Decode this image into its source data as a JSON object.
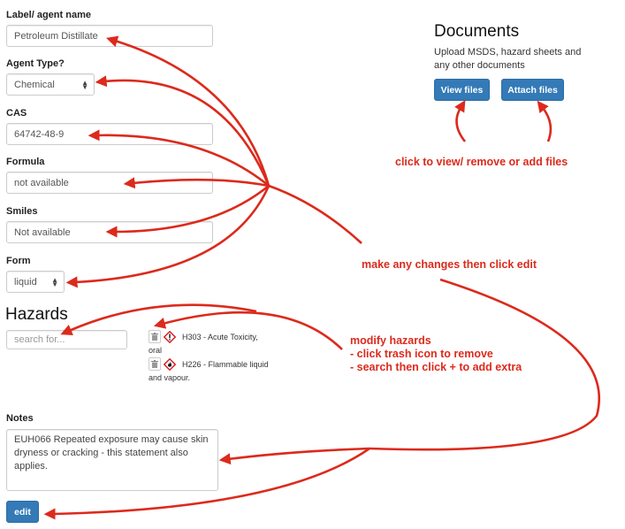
{
  "form": {
    "label_field": {
      "label": "Label/ agent name",
      "value": "Petroleum Distillate"
    },
    "agent_type": {
      "label": "Agent Type?",
      "value": "Chemical"
    },
    "cas": {
      "label": "CAS",
      "value": "64742-48-9"
    },
    "formula": {
      "label": "Formula",
      "value": "not available"
    },
    "smiles": {
      "label": "Smiles",
      "value": "Not available"
    },
    "form_type": {
      "label": "Form",
      "value": "liquid"
    }
  },
  "hazards": {
    "title": "Hazards",
    "search_placeholder": "search for...",
    "items": [
      {
        "code_text": "H303 - Acute Toxicity,",
        "continuation": "oral",
        "icon": "exclamation-icon"
      },
      {
        "code_text": "H226 - Flammable liquid",
        "continuation": "and vapour.",
        "icon": "flame-icon"
      }
    ]
  },
  "notes": {
    "label": "Notes",
    "value": "EUH066 Repeated exposure may cause skin dryness or cracking - this statement also applies."
  },
  "edit_button": "edit",
  "documents": {
    "title": "Documents",
    "description": "Upload MSDS, hazard sheets and any other documents",
    "view_button": "View files",
    "attach_button": "Attach files"
  },
  "annotations": {
    "files_note": "click to view/ remove or add files",
    "edit_note": "make any changes then click edit",
    "hazards_note": [
      "modify hazards",
      "- click trash icon to remove",
      "- search then click + to add extra"
    ]
  },
  "colors": {
    "annotation": "#dc2a1c",
    "primary": "#337ab7"
  }
}
